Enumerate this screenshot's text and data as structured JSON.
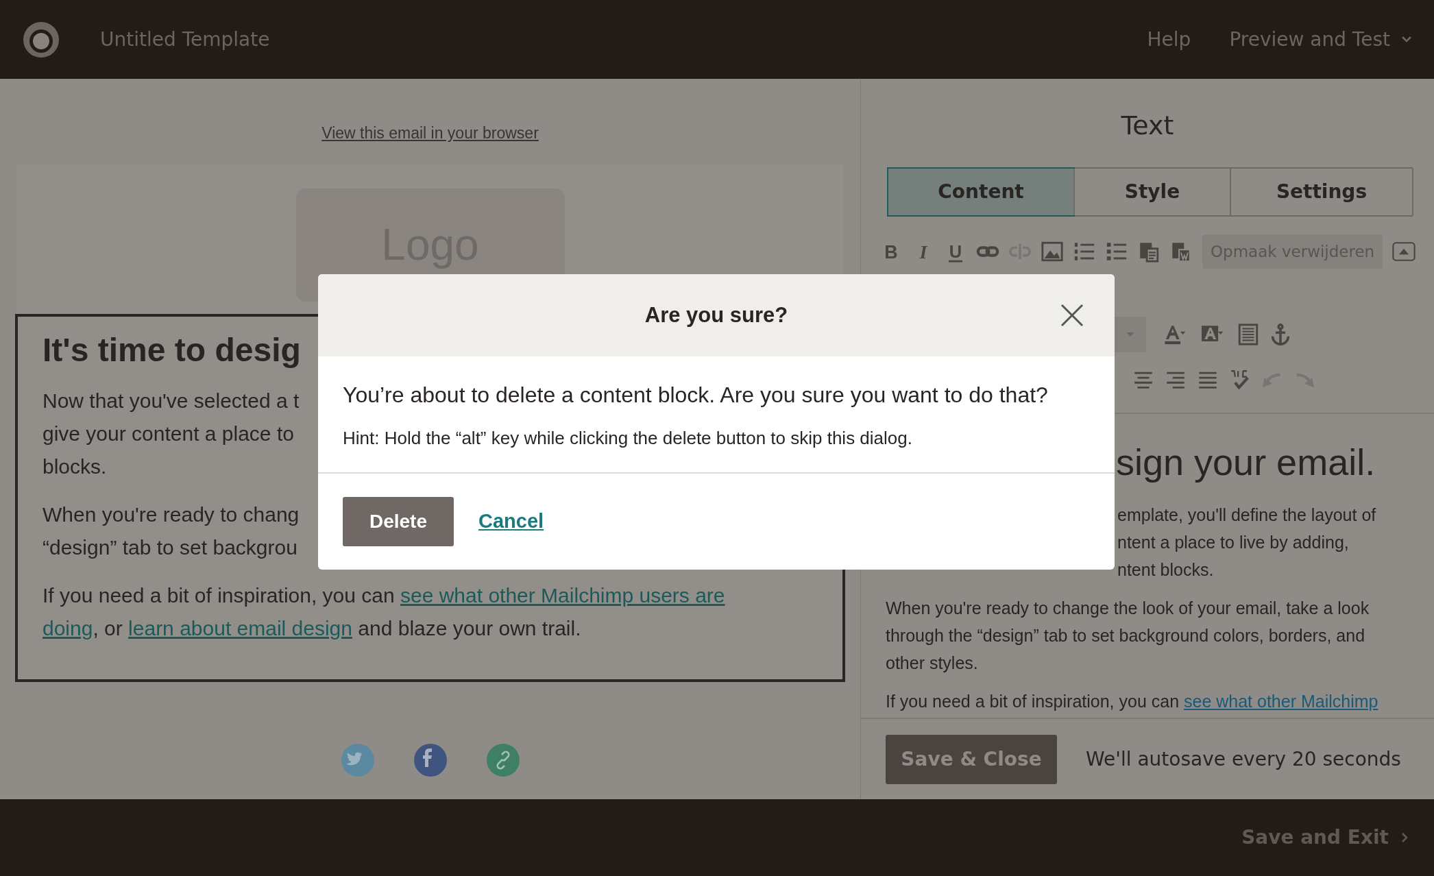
{
  "app_bar": {
    "title": "Untitled Template",
    "help": "Help",
    "menu": "Preview and Test"
  },
  "email_preview": {
    "browser_link": "View this email in your browser",
    "logo": "Logo",
    "text_block": {
      "heading": "It's time to desig",
      "paragraphs": [
        [
          [
            {
              "text": "Now that you've selected a t",
              "link": false
            }
          ],
          [
            {
              "text": "give your content a place to",
              "link": false
            }
          ],
          [
            {
              "text": "blocks.",
              "link": false
            }
          ]
        ],
        [
          [
            {
              "text": "When you're ready to chang",
              "link": false
            }
          ],
          [
            {
              "text": "“design” tab to set backgrou",
              "link": false
            }
          ]
        ],
        [
          [
            {
              "text": "If you need a bit of inspiration, you can ",
              "link": false
            },
            {
              "text": "see what other Mailchimp users are",
              "link": true
            }
          ],
          [
            {
              "text": "doing",
              "link": true
            },
            {
              "text": ", or ",
              "link": false
            },
            {
              "text": "learn about email design",
              "link": true
            },
            {
              "text": " and blaze your own trail.",
              "link": false
            }
          ]
        ]
      ]
    },
    "social": [
      {
        "kind": "twitter"
      },
      {
        "kind": "facebook"
      },
      {
        "kind": "link"
      }
    ]
  },
  "panel": {
    "title": "Text",
    "tabs": [
      {
        "label": "Content",
        "selected": true
      },
      {
        "label": "Style",
        "selected": false
      },
      {
        "label": "Settings",
        "selected": false
      }
    ],
    "toolbar_rows": [
      [
        {
          "kind": "bold",
          "glyph": "B",
          "disabled": false
        },
        {
          "kind": "italic",
          "glyph": "I",
          "disabled": false
        },
        {
          "kind": "underline",
          "glyph": "U",
          "disabled": false
        },
        {
          "kind": "link",
          "disabled": false
        },
        {
          "kind": "unlink",
          "disabled": true
        },
        {
          "kind": "image",
          "disabled": false
        },
        {
          "kind": "ordered-list",
          "disabled": false
        },
        {
          "kind": "bullet-list",
          "disabled": false
        },
        {
          "kind": "paste",
          "disabled": false
        },
        {
          "kind": "paste-word",
          "disabled": false
        },
        {
          "kind": "text-button",
          "label": "Opmaak verwijderen",
          "disabled": false
        },
        {
          "kind": "collapse",
          "disabled": false
        }
      ],
      [
        {
          "kind": "dropdown",
          "disabled": false
        },
        {
          "kind": "text-color",
          "disabled": false
        },
        {
          "kind": "background-color",
          "disabled": false
        },
        {
          "kind": "block",
          "disabled": false
        },
        {
          "kind": "anchor",
          "disabled": false
        }
      ],
      [
        {
          "kind": "align-center",
          "disabled": false
        },
        {
          "kind": "align-right",
          "disabled": false
        },
        {
          "kind": "justify",
          "disabled": false
        },
        {
          "kind": "spellcheck",
          "disabled": false
        },
        {
          "kind": "undo",
          "disabled": true
        },
        {
          "kind": "redo",
          "disabled": true
        }
      ]
    ],
    "editor": {
      "heading": "sign your email.",
      "paragraphs": [
        [
          [
            {
              "text": "emplate, you'll define the layout of",
              "link": false
            }
          ],
          [
            {
              "text": "ntent a place to live by adding,",
              "link": false
            }
          ],
          [
            {
              "text": "ntent blocks.",
              "link": false
            }
          ]
        ],
        [
          [
            {
              "text": "When you're ready to change the look of your email, take a look",
              "link": false
            }
          ],
          [
            {
              "text": "through the “design” tab to set background colors, borders, and",
              "link": false
            }
          ],
          [
            {
              "text": "other styles.",
              "link": false
            }
          ]
        ],
        [
          [
            {
              "text": "If you need a bit of inspiration, you can ",
              "link": false
            },
            {
              "text": "see what other Mailchimp",
              "link": true
            }
          ]
        ]
      ]
    },
    "save_button": "Save & Close",
    "autosave_note": "We'll autosave every 20 seconds"
  },
  "bottom_bar": {
    "save_exit": "Save and Exit"
  },
  "dialog": {
    "title": "Are you sure?",
    "message": "You’re about to delete a content block. Are you sure you want to do that?",
    "hint": "Hint: Hold the “alt” key while clicking the delete button to skip this dialog.",
    "confirm": "Delete",
    "cancel": "Cancel"
  }
}
